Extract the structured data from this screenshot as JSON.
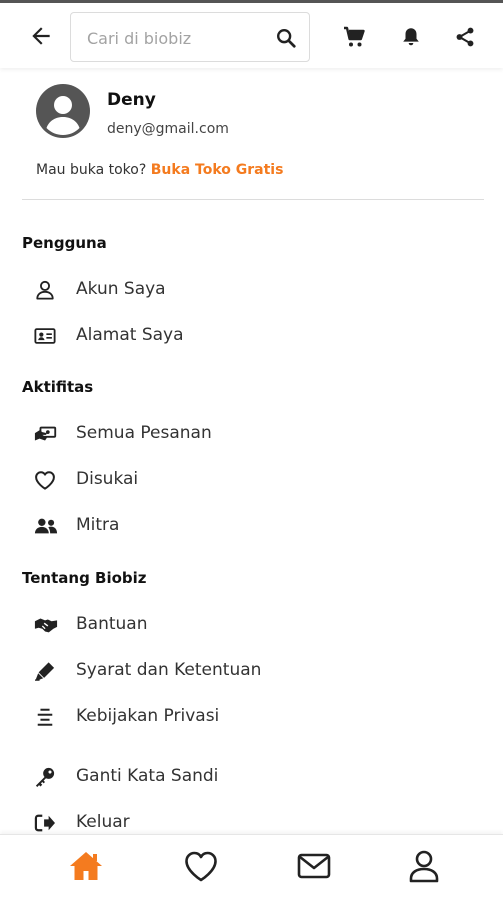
{
  "header": {
    "search_placeholder": "Cari di biobiz",
    "search_value": "",
    "icons": [
      "back-arrow-icon",
      "search-icon",
      "cart-icon",
      "bell-icon",
      "share-icon"
    ]
  },
  "profile": {
    "name": "Deny",
    "email": "deny@gmail.com",
    "shop_prompt": "Mau buka toko?",
    "shop_link": "Buka Toko Gratis"
  },
  "sections": {
    "pengguna": {
      "title": "Pengguna",
      "items": [
        {
          "label": "Akun Saya",
          "icon": "user-icon"
        },
        {
          "label": "Alamat Saya",
          "icon": "address-card-icon"
        }
      ]
    },
    "aktifitas": {
      "title": "Aktifitas",
      "items": [
        {
          "label": "Semua Pesanan",
          "icon": "money-hand-icon"
        },
        {
          "label": "Disukai",
          "icon": "heart-icon"
        },
        {
          "label": "Mitra",
          "icon": "users-icon"
        }
      ]
    },
    "tentang": {
      "title": "Tentang Biobiz",
      "items": [
        {
          "label": "Bantuan",
          "icon": "handshake-icon"
        },
        {
          "label": "Syarat dan Ketentuan",
          "icon": "pen-icon"
        },
        {
          "label": "Kebijakan Privasi",
          "icon": "align-center-icon"
        }
      ]
    },
    "akun": {
      "items": [
        {
          "label": "Ganti Kata Sandi",
          "icon": "key-icon"
        },
        {
          "label": "Keluar",
          "icon": "sign-out-icon"
        }
      ]
    }
  },
  "bottom_nav": {
    "items": [
      "home-icon",
      "heart-icon",
      "envelope-icon",
      "user-icon"
    ],
    "active": "home-icon"
  },
  "colors": {
    "accent": "#f47b1f",
    "icon": "#222222",
    "avatar": "#555555",
    "divider": "#dcdcdc"
  }
}
